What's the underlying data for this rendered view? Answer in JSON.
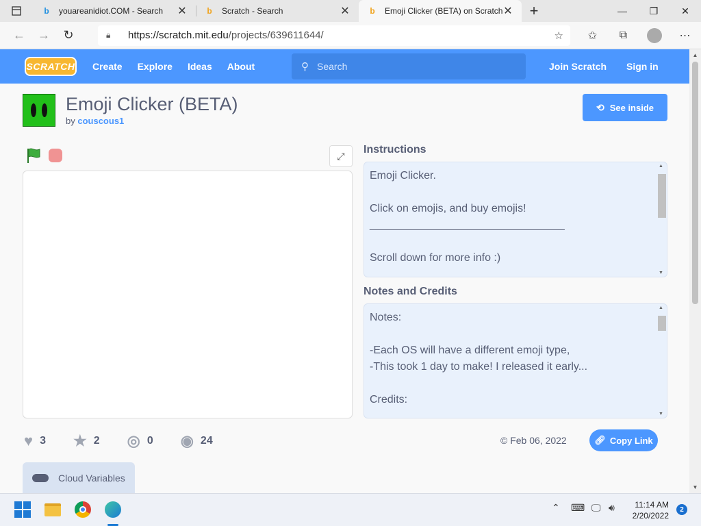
{
  "browser": {
    "tabs": [
      {
        "title": "youareanidiot.COM - Search",
        "favicon": "bing-icon",
        "active": false
      },
      {
        "title": "Scratch - Search",
        "favicon": "bing-icon",
        "active": false
      },
      {
        "title": "Emoji Clicker (BETA) on Scratch",
        "favicon": "bing-icon",
        "active": true
      }
    ],
    "url_host": "https://scratch.mit.edu",
    "url_path": "/projects/639611644/"
  },
  "nav": {
    "logo": "SCRATCH",
    "create": "Create",
    "explore": "Explore",
    "ideas": "Ideas",
    "about": "About",
    "search_placeholder": "Search",
    "join": "Join Scratch",
    "signin": "Sign in",
    "color": "#4c97ff"
  },
  "project": {
    "title": "Emoji Clicker (BETA)",
    "by": "by",
    "author": "couscous1",
    "see_inside": "See inside",
    "instructions_heading": "Instructions",
    "instructions": "Emoji Clicker.\n\nClick on emojis, and buy emojis!\n________________________________\n\nScroll down for more info :)",
    "notes_heading": "Notes and Credits",
    "notes": "Notes:\n\n-Each OS will have a different emoji type,\n-This took 1 day to make! I released it early...\n\nCredits:",
    "stats": {
      "loves": "3",
      "favorites": "2",
      "remixes": "0",
      "views": "24"
    },
    "date": "© Feb 06, 2022",
    "copy_link": "Copy Link",
    "cloud_variables": "Cloud Variables"
  },
  "taskbar": {
    "time": "11:14 AM",
    "date": "2/20/2022",
    "notifications": "2"
  }
}
